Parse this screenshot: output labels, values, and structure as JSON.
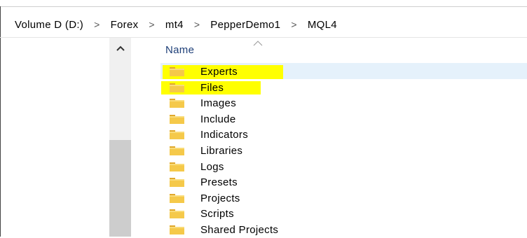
{
  "breadcrumb": {
    "items": [
      "Volume D (D:)",
      "Forex",
      "mt4",
      "PepperDemo1",
      "MQL4"
    ],
    "separator": ">"
  },
  "list": {
    "column_name": "Name",
    "items": [
      "Experts",
      "Files",
      "Images",
      "Include",
      "Indicators",
      "Libraries",
      "Logs",
      "Presets",
      "Projects",
      "Scripts",
      "Shared Projects"
    ],
    "selected": "Experts",
    "highlighted": [
      "Experts",
      "Files"
    ]
  },
  "colors": {
    "highlight": "#ffff00",
    "selection": "#e5f1fb",
    "folder": "#f5c94a",
    "header_text": "#1e3f78"
  },
  "icons": {
    "folder": "folder-icon",
    "scroll_up": "chevron-up-icon",
    "sort": "sort-ascending-icon"
  }
}
